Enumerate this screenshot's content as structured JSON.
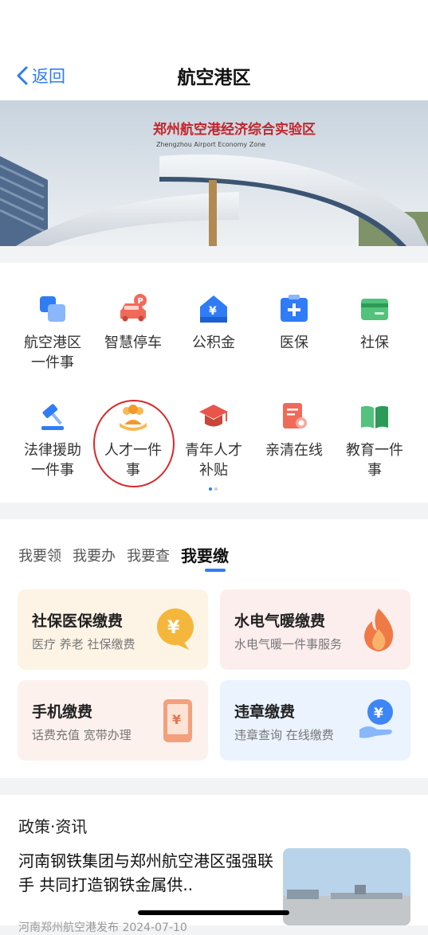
{
  "header": {
    "back_label": "返回",
    "title": "航空港区"
  },
  "banner": {
    "sign_text": "郑州航空港经济综合实验区",
    "sign_subtext": "Zhengzhou  Airport  Economy  Zone"
  },
  "services": [
    {
      "label_l1": "航空港区",
      "label_l2": "一件事",
      "icon": "squares-icon"
    },
    {
      "label_l1": "智慧停车",
      "label_l2": "",
      "icon": "car-parking-icon"
    },
    {
      "label_l1": "公积金",
      "label_l2": "",
      "icon": "house-yen-icon"
    },
    {
      "label_l1": "医保",
      "label_l2": "",
      "icon": "medical-kit-icon"
    },
    {
      "label_l1": "社保",
      "label_l2": "",
      "icon": "card-icon"
    },
    {
      "label_l1": "法律援助",
      "label_l2": "一件事",
      "icon": "gavel-icon"
    },
    {
      "label_l1": "人才一件",
      "label_l2": "事",
      "icon": "people-icon"
    },
    {
      "label_l1": "青年人才",
      "label_l2": "补贴",
      "icon": "graduation-cap-icon"
    },
    {
      "label_l1": "亲清在线",
      "label_l2": "",
      "icon": "certificate-icon"
    },
    {
      "label_l1": "教育一件",
      "label_l2": "事",
      "icon": "open-book-icon"
    }
  ],
  "tabs": [
    "我要领",
    "我要办",
    "我要查",
    "我要缴"
  ],
  "active_tab": "我要缴",
  "pay_tiles": [
    {
      "title": "社保医保缴费",
      "subtitle": "医疗 养老 社保缴费",
      "icon": "yen-bubble-icon",
      "bg": "#fdf4e6"
    },
    {
      "title": "水电气暖缴费",
      "subtitle": "水电气暖一件事服务",
      "icon": "flame-icon",
      "bg": "#fdeeee"
    },
    {
      "title": "手机缴费",
      "subtitle": "话费充值 宽带办理",
      "icon": "phone-yen-icon",
      "bg": "#fdf1ee"
    },
    {
      "title": "违章缴费",
      "subtitle": "违章查询 在线缴费",
      "icon": "hand-yen-icon",
      "bg": "#eaf3fe"
    }
  ],
  "news": {
    "section_title": "政策·资讯",
    "headline": "河南钢铁集团与郑州航空港区强强联手 共同打造钢铁金属供..",
    "meta": "河南郑州航空港发布 2024-07-10"
  },
  "colors": {
    "accent": "#2f7cf6",
    "annotation": "#d8282c"
  }
}
